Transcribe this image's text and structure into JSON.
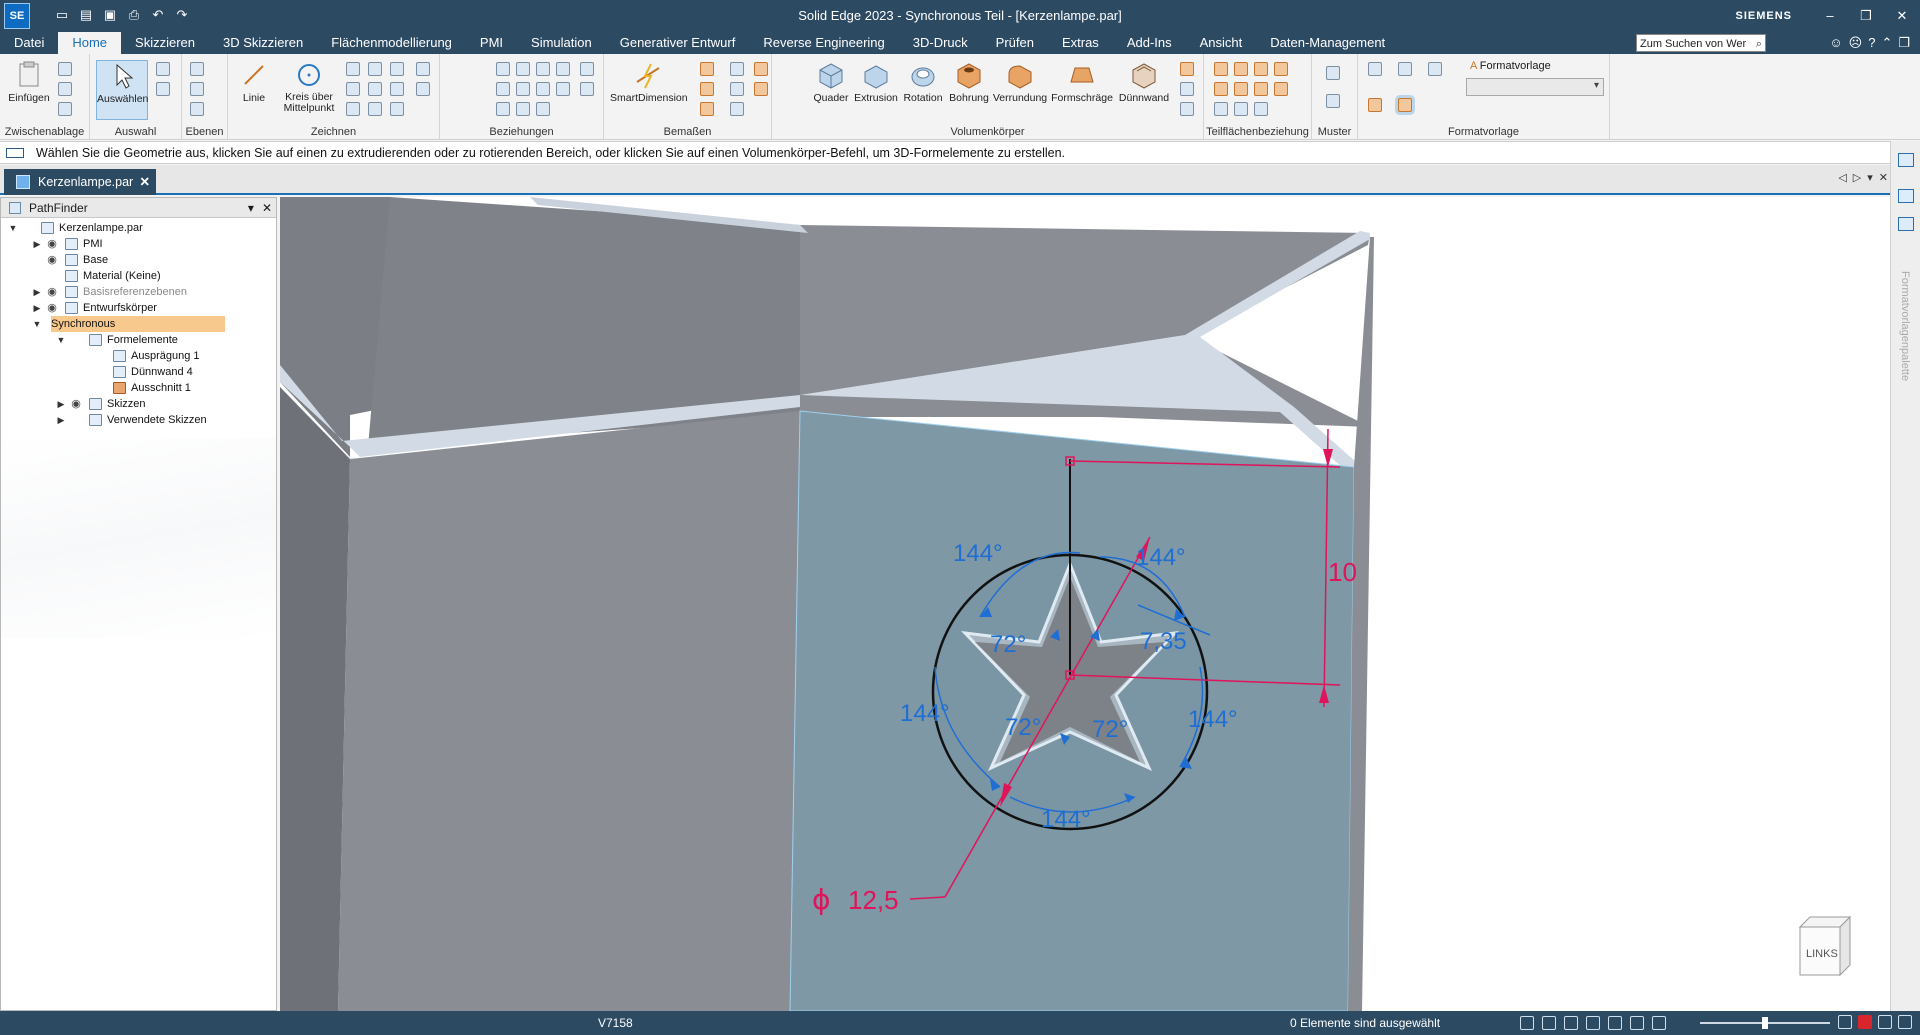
{
  "app": {
    "logo": "SE",
    "title": "Solid Edge 2023 - Synchronous Teil - [Kerzenlampe.par]",
    "brand": "SIEMENS"
  },
  "quick_access": [
    "new-icon",
    "open-icon",
    "save-icon",
    "print-icon",
    "undo-icon",
    "redo-icon"
  ],
  "menu": {
    "file": "Datei",
    "tabs": [
      "Home",
      "Skizzieren",
      "3D Skizzieren",
      "Flächenmodellierung",
      "PMI",
      "Simulation",
      "Generativer Entwurf",
      "Reverse Engineering",
      "3D-Druck",
      "Prüfen",
      "Extras",
      "Add-Ins",
      "Ansicht",
      "Daten-Management"
    ],
    "active_tab": "Home",
    "search_placeholder": "Zum Suchen von Wer"
  },
  "ribbon": {
    "groups": {
      "clipboard": "Zwischenablage",
      "select": "Auswahl",
      "planes": "Ebenen",
      "draw": "Zeichnen",
      "relations": "Beziehungen",
      "dimension": "Bemaßen",
      "solids": "Volumenkörper",
      "face_relations": "Teilflächenbeziehung",
      "pattern": "Muster",
      "style": "Formatvorlage"
    },
    "buttons": {
      "paste": "Einfügen",
      "select": "Auswählen",
      "line": "Linie",
      "circle_l1": "Kreis über",
      "circle_l2": "Mittelpunkt",
      "smart_dimension": "SmartDimension",
      "box": "Quader",
      "extrude": "Extrusion",
      "revolve": "Rotation",
      "hole": "Bohrung",
      "round": "Verrundung",
      "draft": "Formschräge",
      "thinwall": "Dünnwand",
      "style_label": "Formatvorlage"
    }
  },
  "prompt": "Wählen Sie die Geometrie aus, klicken Sie auf einen zu extrudierenden oder zu rotierenden Bereich, oder klicken Sie auf einen Volumenkörper-Befehl, um 3D-Formelemente zu erstellen.",
  "document_tab": "Kerzenlampe.par",
  "pathfinder": {
    "title": "PathFinder",
    "tree": [
      {
        "label": "Kerzenlampe.par",
        "depth": 0,
        "arrow": "open",
        "eye": false,
        "icon": "part-icon"
      },
      {
        "label": "PMI",
        "depth": 1,
        "arrow": "closed",
        "eye": true,
        "icon": "pmi-icon"
      },
      {
        "label": "Base",
        "depth": 1,
        "arrow": "",
        "eye": true,
        "icon": "base-coordinate-icon"
      },
      {
        "label": "Material (Keine)",
        "depth": 1,
        "arrow": "",
        "eye": false,
        "icon": "material-icon"
      },
      {
        "label": "Basisreferenzebenen",
        "depth": 1,
        "arrow": "closed",
        "eye": true,
        "icon": "reference-planes-icon",
        "dim": true
      },
      {
        "label": "Entwurfskörper",
        "depth": 1,
        "arrow": "closed",
        "eye": true,
        "icon": "design-body-icon"
      },
      {
        "label": "Synchronous",
        "depth": 1,
        "arrow": "open",
        "eye": false,
        "icon": "",
        "selected": true
      },
      {
        "label": "Formelemente",
        "depth": 2,
        "arrow": "open",
        "eye": false,
        "icon": "features-icon"
      },
      {
        "label": "Ausprägung 1",
        "depth": 3,
        "arrow": "",
        "eye": false,
        "icon": "protrusion-icon"
      },
      {
        "label": "Dünnwand 4",
        "depth": 3,
        "arrow": "",
        "eye": false,
        "icon": "thinwall-icon"
      },
      {
        "label": "Ausschnitt 1",
        "depth": 3,
        "arrow": "",
        "eye": false,
        "icon": "cutout-icon",
        "orange": true
      },
      {
        "label": "Skizzen",
        "depth": 2,
        "arrow": "closed",
        "eye": true,
        "icon": "sketches-icon"
      },
      {
        "label": "Verwendete Skizzen",
        "depth": 2,
        "arrow": "closed",
        "eye": false,
        "icon": "used-sketches-icon"
      }
    ]
  },
  "viewport": {
    "dimensions": {
      "angles": [
        "144°",
        "144°",
        "72°",
        "72°",
        "72°",
        "144°",
        "144°",
        "144°"
      ],
      "overlap_label": "7,35",
      "vertical_dim": "10",
      "diameter_symbol": "ϕ",
      "diameter": "12,5"
    },
    "view_cube_label": "LINKS",
    "colors": {
      "dimension_blue": "#1f6ed4",
      "dimension_pink": "#e0145a",
      "face_selected": "#7e98a6",
      "body_grey": "#8a8d93"
    }
  },
  "dock": {
    "palette_label": "Formatvorlagenpalette"
  },
  "status": {
    "version": "V7158",
    "selection": "0 Elemente sind ausgewählt"
  }
}
